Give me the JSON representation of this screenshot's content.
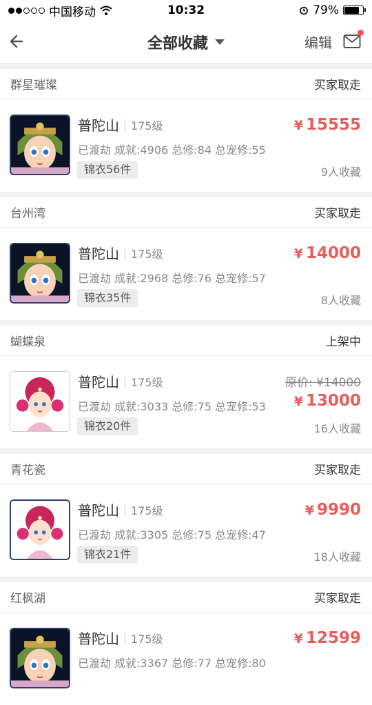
{
  "status_bar": {
    "carrier": "中国移动",
    "time": "10:32",
    "battery": "79%",
    "battery_level": 0.79
  },
  "nav": {
    "title": "全部收藏",
    "edit_label": "编辑"
  },
  "items": [
    {
      "server": "群星璀璨",
      "status": "买家取走",
      "school": "普陀山",
      "level": "175级",
      "stats": "已渡劫 成就:4906 总修:84 总宠修:55",
      "tag": "锦衣56件",
      "currency": "¥",
      "price": "15555",
      "original_price": "",
      "favs": "9人收藏"
    },
    {
      "server": "台州湾",
      "status": "买家取走",
      "school": "普陀山",
      "level": "175级",
      "stats": "已渡劫 成就:2968 总修:76 总宠修:57",
      "tag": "锦衣35件",
      "currency": "¥",
      "price": "14000",
      "original_price": "",
      "favs": "8人收藏"
    },
    {
      "server": "蝴蝶泉",
      "status": "上架中",
      "school": "普陀山",
      "level": "175级",
      "stats": "已渡劫 成就:3033 总修:75 总宠修:53",
      "tag": "锦衣20件",
      "currency": "¥",
      "price": "13000",
      "original_price": "原价: ¥14000",
      "favs": "16人收藏"
    },
    {
      "server": "青花瓷",
      "status": "买家取走",
      "school": "普陀山",
      "level": "175级",
      "stats": "已渡劫 成就:3305 总修:75 总宠修:47",
      "tag": "锦衣21件",
      "currency": "¥",
      "price": "9990",
      "original_price": "",
      "favs": "18人收藏"
    },
    {
      "server": "红枫湖",
      "status": "买家取走",
      "school": "普陀山",
      "level": "175级",
      "stats": "已渡劫 成就:3367 总修:77 总宠修:80",
      "tag": "",
      "currency": "¥",
      "price": "12599",
      "original_price": "",
      "favs": ""
    }
  ],
  "colors": {
    "price": "#e85c5c",
    "accent_dot": "#ff4f4f"
  }
}
